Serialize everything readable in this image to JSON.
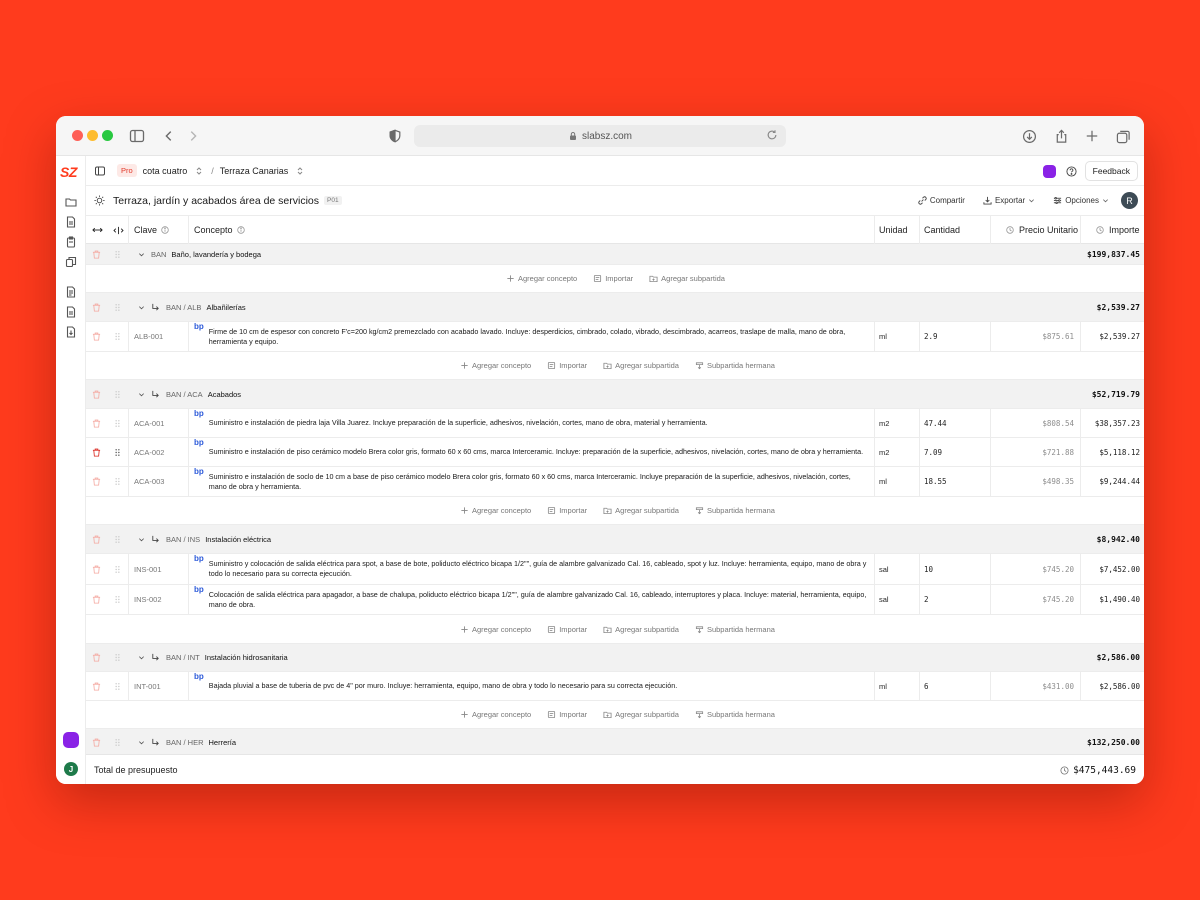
{
  "browser": {
    "url": "slabsz.com"
  },
  "app": {
    "logo": "SZ",
    "rail_avatar": "J"
  },
  "topbar": {
    "plan": "Pro",
    "project": "cota cuatro",
    "budget": "Terraza Canarias",
    "feedback_label": "Feedback"
  },
  "docbar": {
    "title": "Terraza, jardín y acabados área de servicios",
    "code": "P01",
    "share_label": "Compartir",
    "export_label": "Exportar",
    "options_label": "Opciones",
    "avatar": "R"
  },
  "columns": {
    "clave": "Clave",
    "concepto": "Concepto",
    "unidad": "Unidad",
    "cantidad": "Cantidad",
    "precio": "Precio Unitario",
    "importe": "Importe"
  },
  "actions": {
    "add_concept": "Agregar concepto",
    "import": "Importar",
    "add_subgroup": "Agregar subpartida",
    "sibling_subgroup": "Subpartida hermana"
  },
  "groups": {
    "ban": {
      "code": "BAN",
      "name": "Baño, lavandería y bodega",
      "total": "$199,837.45"
    },
    "alb": {
      "code": "BAN / ALB",
      "name": "Albañilerías",
      "total": "$2,539.27"
    },
    "aca": {
      "code": "BAN / ACA",
      "name": "Acabados",
      "total": "$52,719.79"
    },
    "ins": {
      "code": "BAN / INS",
      "name": "Instalación eléctrica",
      "total": "$8,942.40"
    },
    "int": {
      "code": "BAN / INT",
      "name": "Instalación hidrosanitaria",
      "total": "$2,586.00"
    },
    "her": {
      "code": "BAN / HER",
      "name": "Herrería",
      "total": "$132,250.00"
    }
  },
  "items": {
    "alb1": {
      "code": "ALB-001",
      "badge": "bp",
      "concept": "Firme de 10 cm de espesor con concreto F'c=200 kg/cm2 premezclado con acabado lavado. Incluye: desperdicios, cimbrado, colado, vibrado, descimbrado, acarreos, traslape de malla, mano de obra, herramienta y equipo.",
      "unit": "ml",
      "qty": "2.9",
      "price": "$875.61",
      "amount": "$2,539.27"
    },
    "aca1": {
      "code": "ACA-001",
      "badge": "bp",
      "concept": "Suministro e instalación de piedra laja Villa Juarez. Incluye preparación de la superficie, adhesivos, nivelación, cortes, mano de obra, material y herramienta.",
      "unit": "m2",
      "qty": "47.44",
      "price": "$808.54",
      "amount": "$38,357.23"
    },
    "aca2": {
      "code": "ACA-002",
      "badge": "bp",
      "concept": "Suministro e instalación de piso cerámico modelo Brera color gris, formato 60 x 60 cms, marca Interceramic. Incluye: preparación de la superficie, adhesivos, nivelación, cortes, mano de obra y herramienta.",
      "unit": "m2",
      "qty": "7.09",
      "price": "$721.88",
      "amount": "$5,118.12"
    },
    "aca3": {
      "code": "ACA-003",
      "badge": "bp",
      "concept": "Suministro e instalación de soclo de 10 cm a base de piso cerámico modelo Brera color gris, formato 60 x 60 cms, marca Interceramic. Incluye preparación de la superficie, adhesivos, nivelación, cortes, mano de obra y herramienta.",
      "unit": "ml",
      "qty": "18.55",
      "price": "$498.35",
      "amount": "$9,244.44"
    },
    "ins1": {
      "code": "INS-001",
      "badge": "bp",
      "concept": "Suministro y colocación de salida eléctrica para spot, a base de bote, poliducto eléctrico bicapa 1/2\"\", guía de alambre galvanizado Cal. 16, cableado, spot y luz. Incluye: herramienta, equipo, mano de obra y todo lo necesario para su correcta ejecución.",
      "unit": "sal",
      "qty": "10",
      "price": "$745.20",
      "amount": "$7,452.00"
    },
    "ins2": {
      "code": "INS-002",
      "badge": "bp",
      "concept": "Colocación de salida eléctrica para apagador, a base de chalupa, poliducto eléctrico bicapa 1/2\"\", guía de alambre galvanizado Cal. 16, cableado, interruptores y placa. Incluye: material, herramienta, equipo, mano de obra.",
      "unit": "sal",
      "qty": "2",
      "price": "$745.20",
      "amount": "$1,490.40"
    },
    "int1": {
      "code": "INT-001",
      "badge": "bp",
      "concept": "Bajada pluvial a base de tuberia de pvc de 4\" por muro. Incluye: herramienta, equipo, mano de obra y todo lo necesario para su correcta ejecución.",
      "unit": "ml",
      "qty": "6",
      "price": "$431.00",
      "amount": "$2,586.00"
    }
  },
  "footer": {
    "label": "Total de presupuesto",
    "total": "$475,443.69"
  }
}
